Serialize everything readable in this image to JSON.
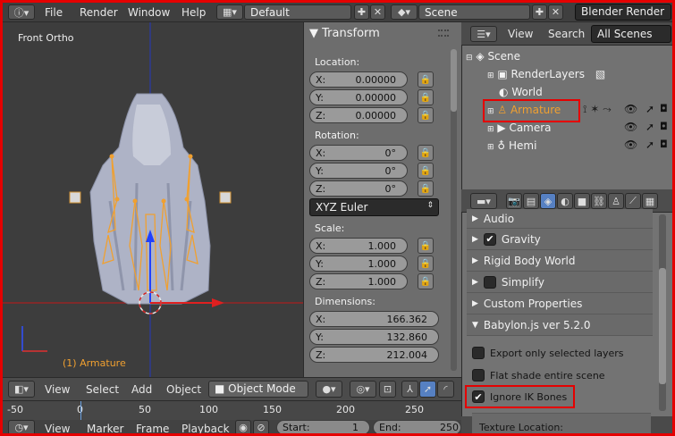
{
  "topbar": {
    "menus": [
      "File",
      "Render",
      "Window",
      "Help"
    ],
    "screen_layout": "Default",
    "scene": "Scene",
    "engine": "Blender Render"
  },
  "viewport": {
    "view_name": "Front Ortho",
    "object_label": "(1) Armature"
  },
  "transform": {
    "title": "Transform",
    "location_label": "Location:",
    "location": [
      {
        "k": "X:",
        "v": "0.00000"
      },
      {
        "k": "Y:",
        "v": "0.00000"
      },
      {
        "k": "Z:",
        "v": "0.00000"
      }
    ],
    "rotation_label": "Rotation:",
    "rotation": [
      {
        "k": "X:",
        "v": "0°"
      },
      {
        "k": "Y:",
        "v": "0°"
      },
      {
        "k": "Z:",
        "v": "0°"
      }
    ],
    "rotation_mode": "XYZ Euler",
    "scale_label": "Scale:",
    "scale": [
      {
        "k": "X:",
        "v": "1.000"
      },
      {
        "k": "Y:",
        "v": "1.000"
      },
      {
        "k": "Z:",
        "v": "1.000"
      }
    ],
    "dimensions_label": "Dimensions:",
    "dimensions": [
      {
        "k": "X:",
        "v": "166.362"
      },
      {
        "k": "Y:",
        "v": "132.860"
      },
      {
        "k": "Z:",
        "v": "212.004"
      }
    ]
  },
  "outliner": {
    "view": "View",
    "search": "Search",
    "filter": "All Scenes",
    "items": [
      "Scene",
      "RenderLayers",
      "World",
      "Armature",
      "Camera",
      "Hemi"
    ]
  },
  "properties": {
    "sections": [
      "Audio",
      "Gravity",
      "Rigid Body World",
      "Simplify",
      "Custom Properties",
      "Babylon.js ver 5.2.0"
    ],
    "options": [
      "Export only selected layers",
      "Flat shade entire scene",
      "Ignore IK Bones"
    ],
    "texture_location": "Texture Location:"
  },
  "viewport_header": {
    "menus": [
      "View",
      "Select",
      "Add",
      "Object"
    ],
    "mode": "Object Mode"
  },
  "timeline": {
    "ticks": [
      "-50",
      "0",
      "50",
      "100",
      "150",
      "200",
      "250"
    ],
    "menus": [
      "View",
      "Marker",
      "Frame",
      "Playback"
    ],
    "start_label": "Start:",
    "start_value": "1",
    "end_label": "End:",
    "end_value": "250"
  },
  "colors": {
    "highlight": "#e50000",
    "selection": "#f0a030",
    "x_axis": "#e02020",
    "z_axis": "#2040ff"
  }
}
